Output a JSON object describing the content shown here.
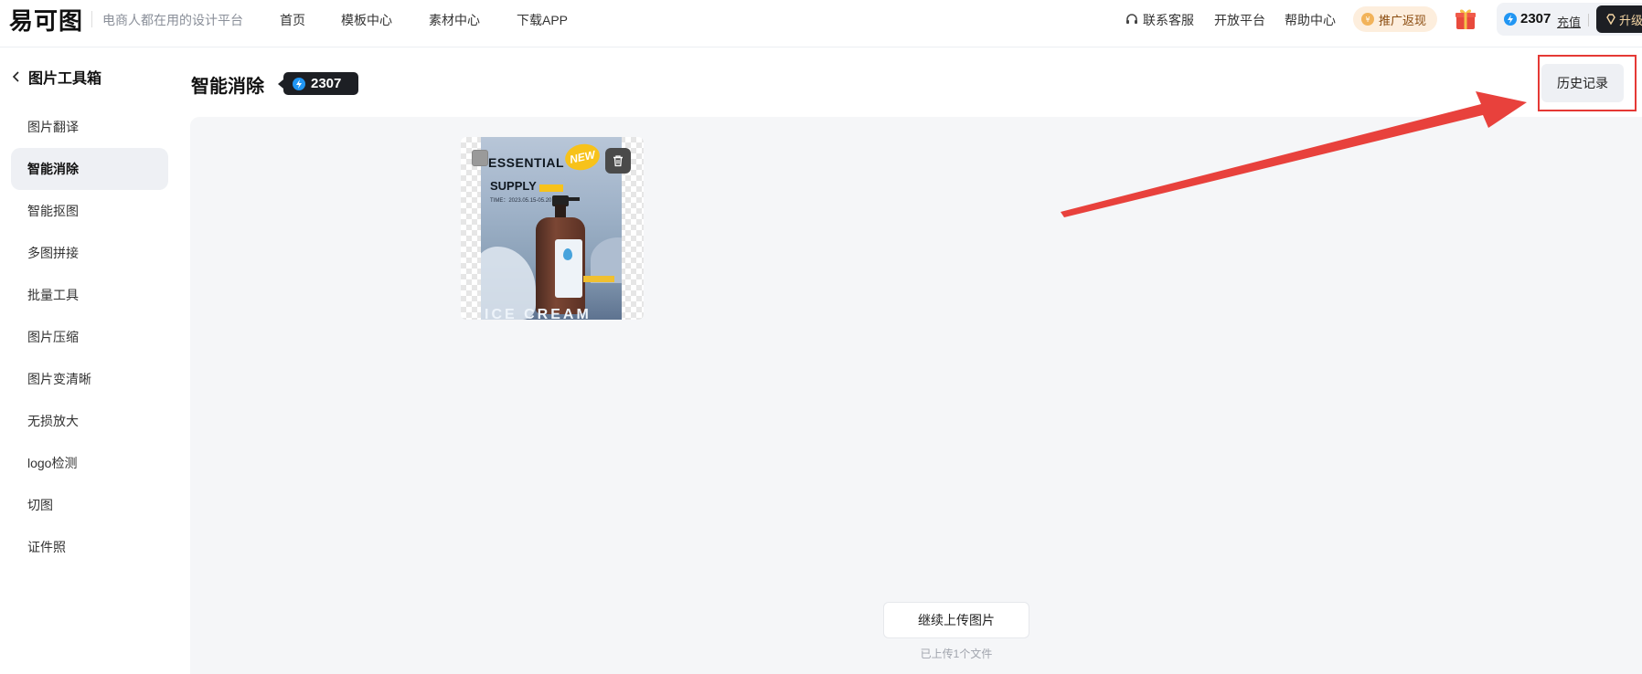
{
  "header": {
    "logo_text": "易可图",
    "slogan": "电商人都在用的设计平台",
    "nav": [
      "首页",
      "模板中心",
      "素材中心",
      "下载APP"
    ],
    "support": "联系客服",
    "open_platform": "开放平台",
    "help": "帮助中心",
    "promo": "推广返现",
    "points": "2307",
    "recharge": "充值",
    "upgrade": "升级"
  },
  "sidebar": {
    "back_label": "图片工具箱",
    "items": [
      {
        "label": "图片翻译"
      },
      {
        "label": "智能消除",
        "active": true
      },
      {
        "label": "智能抠图"
      },
      {
        "label": "多图拼接"
      },
      {
        "label": "批量工具"
      },
      {
        "label": "图片压缩"
      },
      {
        "label": "图片变清晰"
      },
      {
        "label": "无损放大"
      },
      {
        "label": "logo检测"
      },
      {
        "label": "切图"
      },
      {
        "label": "证件照"
      }
    ]
  },
  "main": {
    "title": "智能消除",
    "points_badge": "2307",
    "history_button": "历史记录",
    "upload_more": "继续上传图片",
    "upload_count": "已上传1个文件"
  },
  "poster": {
    "title_line1": "ESSENTIAL",
    "title_line2": "SUPPLY",
    "badge": "NEW",
    "time": "TIME：2023.05.15-05.20",
    "bottom": "ICE CREAM"
  },
  "colors": {
    "accent_dark": "#1d1f24",
    "highlight_red": "#e53935",
    "coin_blue": "#2196f3",
    "workspace_bg": "#f5f6f8"
  }
}
